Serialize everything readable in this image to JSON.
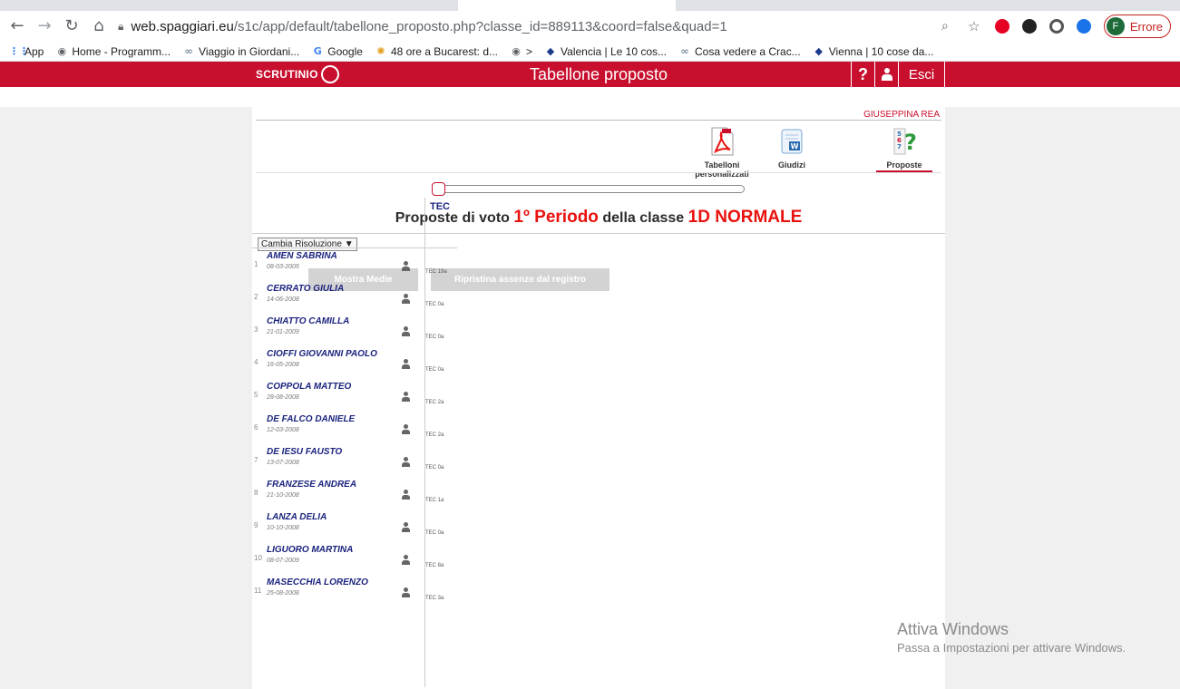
{
  "browser": {
    "url_host": "web.spaggiari.eu",
    "url_path": "/s1c/app/default/tabellone_proposto.php?classe_id=889113&coord=false&quad=1",
    "profile_initial": "F",
    "profile_status": "Errore",
    "bookmarks": [
      {
        "label": "App",
        "icon": "apps-grid-icon"
      },
      {
        "label": "Home - Programm...",
        "icon": "globe-icon"
      },
      {
        "label": "Viaggio in Giordani...",
        "icon": "link-icon"
      },
      {
        "label": "Google",
        "icon": "google-icon"
      },
      {
        "label": "48 ore a Bucarest: d...",
        "icon": "sun-icon"
      },
      {
        "label": ">",
        "icon": "globe-icon"
      },
      {
        "label": "Valencia | Le 10 cos...",
        "icon": "site-logo-icon"
      },
      {
        "label": "Cosa vedere a Crac...",
        "icon": "link-icon"
      },
      {
        "label": "Vienna | 10 cose da...",
        "icon": "site-logo-icon"
      }
    ]
  },
  "site": {
    "logo": "SCRUTINIO",
    "title": "Tabellone proposto",
    "help": "?",
    "exit": "Esci",
    "teacher": "GIUSEPPINA REA"
  },
  "tools": {
    "pdf_label": "Tabelloni personalizzati",
    "giudizi_label": "Giudizi",
    "proposte_label": "Proposte"
  },
  "heading": {
    "prefix": "Proposte di voto",
    "period": "1º Periodo",
    "middle": "della classe",
    "class_name": "1D NORMALE"
  },
  "controls": {
    "resolution": "Cambia Risoluzione ▼",
    "show_averages": "Mostra Medie",
    "restore_absences": "Ripristina assenze dal registro"
  },
  "table": {
    "subject": "TEC",
    "students": [
      {
        "n": "1",
        "name": "AMEN SABRINA",
        "dob": "08-03-2005",
        "val": "TEC  19a"
      },
      {
        "n": "2",
        "name": "CERRATO GIULIA",
        "dob": "14-06-2008",
        "val": "TEC  0a"
      },
      {
        "n": "3",
        "name": "CHIATTO CAMILLA",
        "dob": "21-01-2009",
        "val": "TEC  0a"
      },
      {
        "n": "4",
        "name": "CIOFFI GIOVANNI PAOLO",
        "dob": "16-05-2008",
        "val": "TEC  0a"
      },
      {
        "n": "5",
        "name": "COPPOLA MATTEO",
        "dob": "28-08-2008",
        "val": "TEC  2a"
      },
      {
        "n": "6",
        "name": "DE FALCO DANIELE",
        "dob": "12-03-2008",
        "val": "TEC  2a"
      },
      {
        "n": "7",
        "name": "DE IESU FAUSTO",
        "dob": "13-07-2008",
        "val": "TEC  0a"
      },
      {
        "n": "8",
        "name": "FRANZESE ANDREA",
        "dob": "21-10-2008",
        "val": "TEC  1a"
      },
      {
        "n": "9",
        "name": "LANZA DELIA",
        "dob": "10-10-2008",
        "val": "TEC  0a"
      },
      {
        "n": "10",
        "name": "LIGUORO MARTINA",
        "dob": "08-07-2009",
        "val": "TEC  8a"
      },
      {
        "n": "11",
        "name": "MASECCHIA LORENZO",
        "dob": "25-08-2008",
        "val": "TEC  3a"
      }
    ]
  },
  "watermark": {
    "line1": "Attiva Windows",
    "line2": "Passa a Impostazioni per attivare Windows."
  },
  "colors": {
    "brand_red": "#c8102e",
    "heading_red": "#e8120e",
    "name_blue": "#1a237e"
  }
}
